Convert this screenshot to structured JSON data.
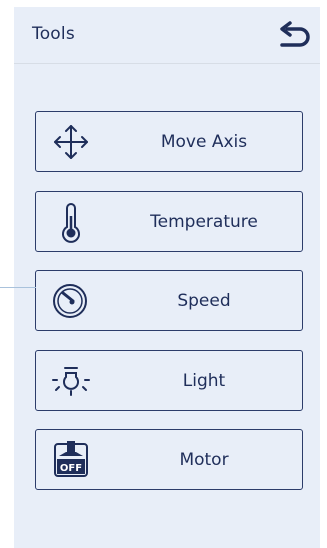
{
  "header": {
    "title": "Tools"
  },
  "menu": [
    {
      "id": "move-axis",
      "label": "Move Axis",
      "icon": "move-axis-icon"
    },
    {
      "id": "temperature",
      "label": "Temperature",
      "icon": "thermometer-icon"
    },
    {
      "id": "speed",
      "label": "Speed",
      "icon": "speedometer-icon"
    },
    {
      "id": "light",
      "label": "Light",
      "icon": "light-bulb-icon"
    },
    {
      "id": "motor",
      "label": "Motor",
      "icon": "motor-off-switch-icon",
      "icon_text": "OFF"
    }
  ],
  "colors": {
    "panel_bg": "#e8eef8",
    "accent": "#1f2e5a",
    "border": "#2c3c6a"
  }
}
